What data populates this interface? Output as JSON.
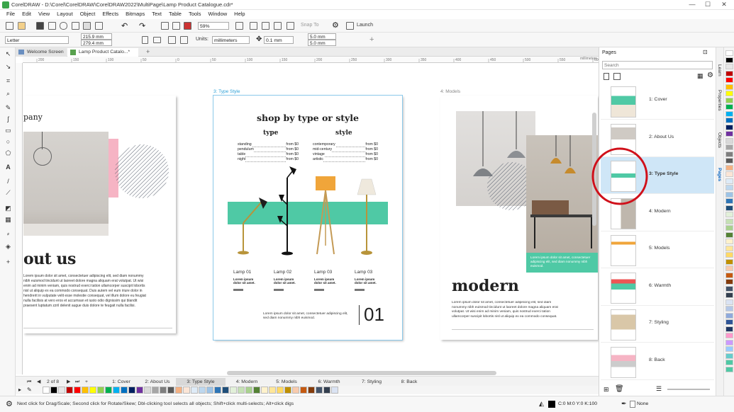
{
  "window": {
    "title": "CorelDRAW - D:\\Corel\\CorelDRAW\\CorelDRAW2022\\MultiPage\\Lamp Product Catalogue.cdr*"
  },
  "menu": [
    "File",
    "Edit",
    "View",
    "Layout",
    "Object",
    "Effects",
    "Bitmaps",
    "Text",
    "Table",
    "Tools",
    "Window",
    "Help"
  ],
  "toolbar": {
    "zoom": "59%",
    "snap_label": "Snap To",
    "launch_label": "Launch"
  },
  "property_bar": {
    "page_size": "Letter",
    "width": "215.9 mm",
    "height": "279.4 mm",
    "units_label": "Units:",
    "units": "millimeters",
    "nudge": "0.1 mm",
    "dup_x": "5.0 mm",
    "dup_y": "5.0 mm"
  },
  "doc_tabs": [
    {
      "label": "Welcome Screen"
    },
    {
      "label": "Lamp Product Catalo...*"
    }
  ],
  "ruler": {
    "unit": "millimeters",
    "ticks": [
      "200",
      "150",
      "100",
      "50",
      "0",
      "50",
      "100",
      "150",
      "200",
      "250",
      "300",
      "350",
      "400",
      "450",
      "500",
      "550",
      "600"
    ]
  },
  "canvas": {
    "page2": {
      "heading_partial": "pany",
      "title_partial": "out us",
      "body": "Lorem ipsum dolor sit amet, consectetuer adipiscing elit, sed diam nonummy nibh euismod tincidunt ut laoreet dolore magna aliquam erat volutpat. Ut wisi enim ad minim veniam, quis nostrud exerci tation ullamcorper suscipit lobortis nisl ut aliquip ex ea commodo consequat. Duis autem vel eum iriure dolor in hendrerit in vulputate velit esse molestie consequat, vel illum dolore eu feugiat nulla facilisis at vero eros et accumsan et iusto odio dignissim qui blandit praesent luptatum zzril delenit augue duis dolore te feugait nulla facilisi."
    },
    "page3": {
      "label": "3: Type Style",
      "title": "shop by type or style",
      "col1_head": "type",
      "col2_head": "style",
      "type_items": [
        {
          "name": "standing",
          "price": "from $0"
        },
        {
          "name": "pendulum",
          "price": "from $0"
        },
        {
          "name": "table",
          "price": "from $0"
        },
        {
          "name": "night",
          "price": "from $0"
        }
      ],
      "style_items": [
        {
          "name": "contemporary",
          "price": "from $0"
        },
        {
          "name": "mid-century",
          "price": "from $0"
        },
        {
          "name": "vintage",
          "price": "from $0"
        },
        {
          "name": "artistic",
          "price": "from $0"
        }
      ],
      "lamps": [
        {
          "name": "Lamp 01",
          "desc": "Lorem ipsum dolor sit amet."
        },
        {
          "name": "Lamp 02",
          "desc": "Lorem ipsum dolor sit amet."
        },
        {
          "name": "Lamp 03",
          "desc": "Lorem ipsum dolor sit amet."
        },
        {
          "name": "Lamp 03",
          "desc": "Lorem ipsum dolor sit amet."
        }
      ],
      "footer_text": "Lorem ipsum dolor sit amet, consectetuer adipiscing elit, sed diam nonummy nibh euismod.",
      "page_number": "01"
    },
    "page4": {
      "label": "4: Models",
      "title": "modern",
      "body": "Lorem ipsum dolor sit amet, consectetuer adipiscing elit, sed diam nonummy nibh euismod tincidunt ut laoreet dolore magna aliquam erat volutpat. Ut wisi enim ad minim veniam, quis nostrud exerci tation ullamcorper suscipit lobortis nisl ut aliquip ex ea commodo consequat.",
      "caption": "Lorem ipsum dolor sit amet, consectetuer adipiscing elit, sed diam nonummy nibh euismod."
    }
  },
  "page_nav": {
    "counter": "2 of 8",
    "tabs": [
      "1: Cover",
      "2: About Us",
      "3: Type Style",
      "4: Modern",
      "5: Models",
      "6: Warmth",
      "7: Styling",
      "8: Back"
    ]
  },
  "pages_docker": {
    "title": "Pages",
    "search_placeholder": "Search",
    "pages": [
      "1: Cover",
      "2: About Us",
      "3: Type Style",
      "4: Modern",
      "5: Models",
      "6: Warmth",
      "7: Styling",
      "8: Back"
    ],
    "selected_index": 2
  },
  "side_tabs": [
    "Learn",
    "Properties",
    "Objects",
    "Pages"
  ],
  "palette_colors": [
    "#ffffff",
    "#000000",
    "#e7e6e6",
    "#c00000",
    "#ff0000",
    "#ffc000",
    "#ffff00",
    "#92d050",
    "#00b050",
    "#00b0f0",
    "#0070c0",
    "#002060",
    "#7030a0",
    "#d9d9d9",
    "#a6a6a6",
    "#7f7f7f",
    "#595959",
    "#f4b183",
    "#fbe5d6",
    "#deebf7",
    "#bdd7ee",
    "#9dc3e6",
    "#2e75b6",
    "#1f4e79",
    "#e2f0d9",
    "#c5e0b4",
    "#a9d18e",
    "#548235",
    "#fff2cc",
    "#ffe699",
    "#ffd966",
    "#bf9000",
    "#f8cbad",
    "#c55a11",
    "#843c0c",
    "#44546a",
    "#333f4f",
    "#dae3f3",
    "#b4c7e7",
    "#8faadc",
    "#2f5597",
    "#203864",
    "#ff99cc",
    "#cc99ff",
    "#99ccff",
    "#66cccc",
    "#4fc9a5",
    "#4fc9a5"
  ],
  "status": {
    "hint": "Next click for Drag/Scale; Second click for Rotate/Skew; Dbl-clicking tool selects all objects; Shift+click multi-selects; Alt+click digs",
    "fill": "C:0 M:0 Y:0 K:100",
    "outline": "None"
  },
  "colors": {
    "accent_teal": "#4fc9a5",
    "highlight_red": "#d0101a",
    "selection_blue": "#cfe6f7",
    "pink": "#f6b4c4"
  }
}
